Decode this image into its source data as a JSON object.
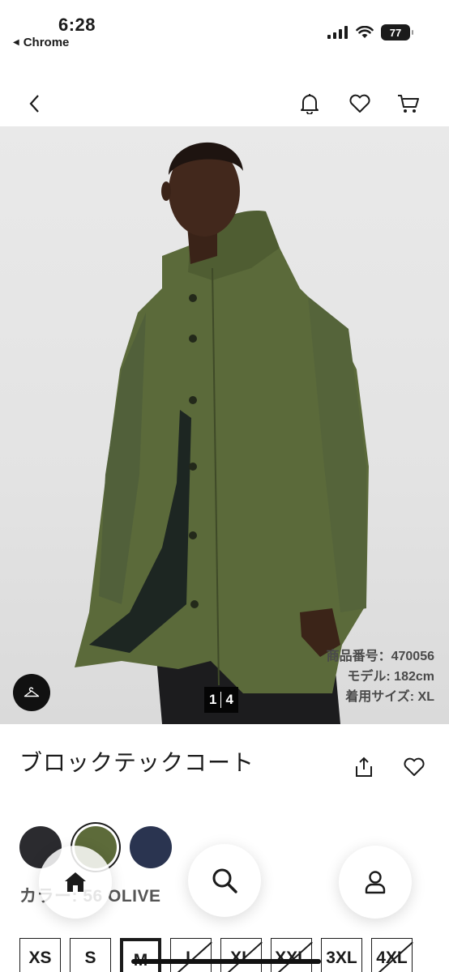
{
  "status_bar": {
    "time": "6:28",
    "back_app": "Chrome",
    "battery": "77",
    "icons": [
      "signal-icon",
      "wifi-icon",
      "battery-icon"
    ]
  },
  "header": {
    "icons": [
      "back-chevron-icon",
      "bell-icon",
      "heart-icon",
      "cart-icon"
    ]
  },
  "hero": {
    "meta": {
      "product_number": "商品番号：470056",
      "model_height": "モデル: 182cm",
      "size_worn": "着用サイズ: XL"
    },
    "pager": {
      "current": "1",
      "total": "4"
    },
    "fit_icon": "hanger-icon"
  },
  "product": {
    "title": "ブロックテックコート"
  },
  "colors": {
    "label": "カラー: 56 OLIVE",
    "swatches": [
      {
        "name": "black",
        "hex": "#2b2b2f"
      },
      {
        "name": "olive",
        "hex": "#5d6b3a",
        "selected": true
      },
      {
        "name": "navy",
        "hex": "#2a3450"
      }
    ]
  },
  "sizes": [
    {
      "label": "XS",
      "available": true
    },
    {
      "label": "S",
      "available": true
    },
    {
      "label": "M",
      "available": true,
      "selected": true
    },
    {
      "label": "L",
      "available": false
    },
    {
      "label": "XL",
      "available": false
    },
    {
      "label": "XXL",
      "available": false
    },
    {
      "label": "3XL",
      "available": true
    },
    {
      "label": "4XL",
      "available": false
    }
  ],
  "tab_bar": {
    "icons": [
      "home-icon",
      "search-icon",
      "account-icon"
    ]
  },
  "theme": {
    "coat_color": "#5b6a3a",
    "text": "#1b1b1b"
  }
}
